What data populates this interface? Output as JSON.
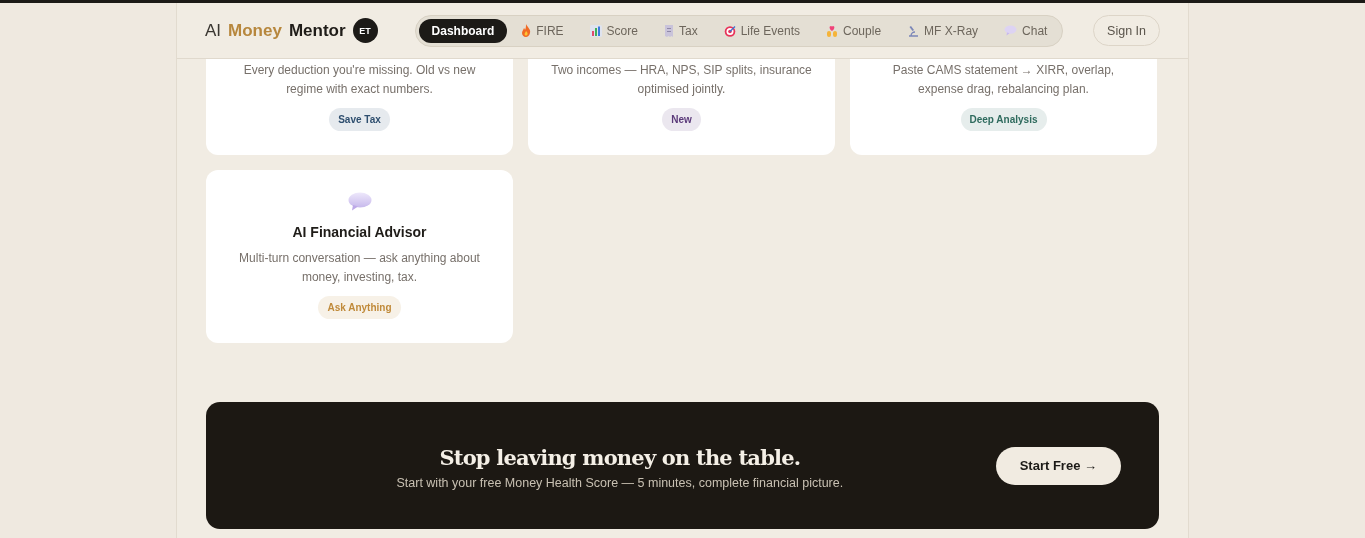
{
  "header": {
    "logo": {
      "prefix": "AI",
      "accent": "Money",
      "suffix": "Mentor",
      "badge": "ET"
    },
    "nav": [
      {
        "label": "Dashboard",
        "selected": true
      },
      {
        "label": "FIRE",
        "selected": false
      },
      {
        "label": "Score",
        "selected": false
      },
      {
        "label": "Tax",
        "selected": false
      },
      {
        "label": "Life Events",
        "selected": false
      },
      {
        "label": "Couple",
        "selected": false
      },
      {
        "label": "MF X-Ray",
        "selected": false
      },
      {
        "label": "Chat",
        "selected": false
      }
    ],
    "sign_in": "Sign In"
  },
  "cards": [
    {
      "description": "Every deduction you're missing. Old vs new regime with exact numbers.",
      "tag": {
        "label": "Save Tax",
        "color": "#2f4f6f"
      }
    },
    {
      "description": "Two incomes — HRA, NPS, SIP splits, insurance optimised jointly.",
      "tag": {
        "label": "New",
        "color": "#5b3a7a"
      }
    },
    {
      "description": "Paste CAMS statement → XIRR, overlap, expense drag, rebalancing plan.",
      "tag": {
        "label": "Deep Analysis",
        "color": "#2f6b5e"
      }
    },
    {
      "title": "AI Financial Advisor",
      "description": "Multi-turn conversation — ask anything about money, investing, tax.",
      "tag": {
        "label": "Ask Anything",
        "color": "#c08a3a"
      }
    }
  ],
  "cta": {
    "heading": "Stop leaving money on the table.",
    "subtitle": "Start with your free Money Health Score — 5 minutes, complete financial picture.",
    "button": "Start Free →"
  }
}
